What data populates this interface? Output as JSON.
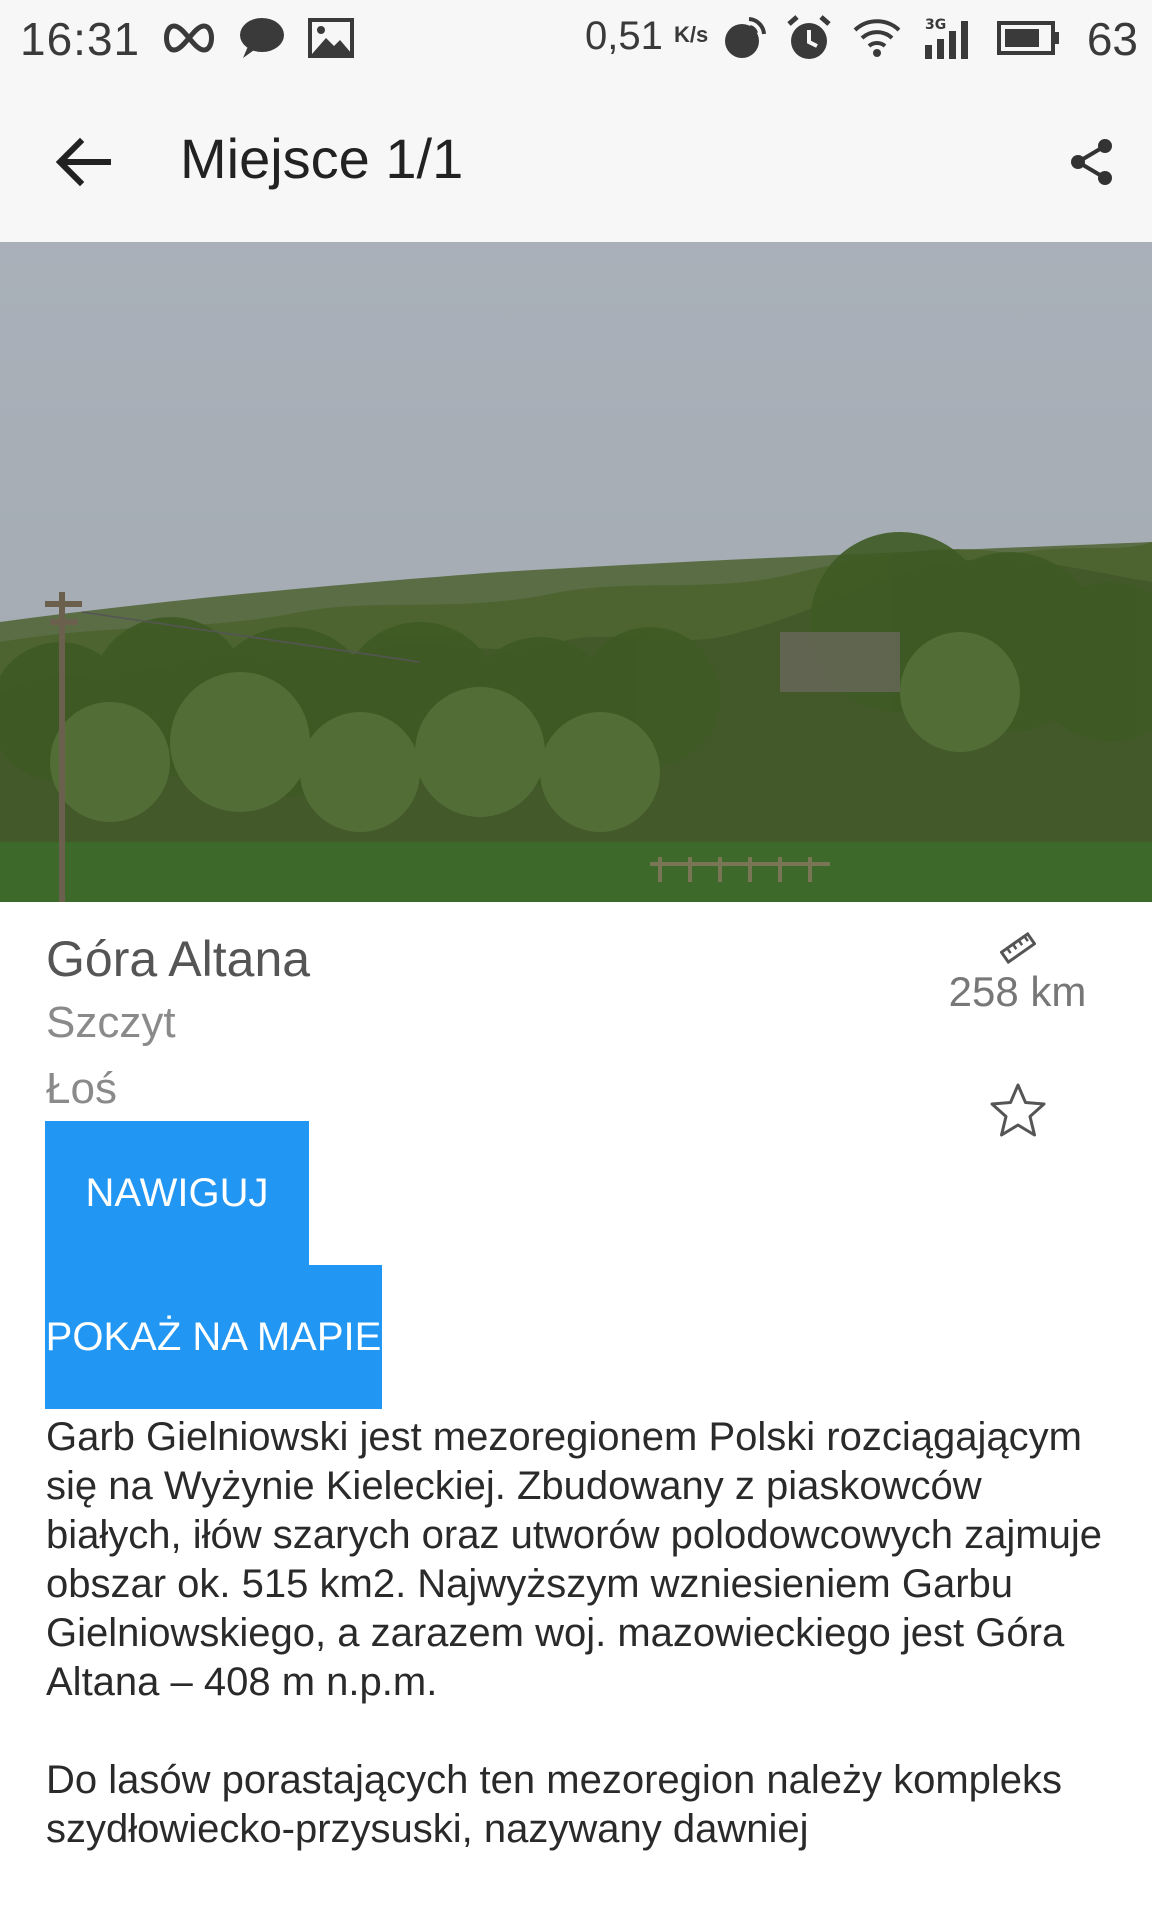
{
  "status_bar": {
    "time": "16:31",
    "network_speed": "0,51",
    "network_speed_unit": "K/s",
    "network_type": "3G",
    "battery_level": "63",
    "icons": [
      "infinity-icon",
      "chat-bubble-icon",
      "image-icon",
      "sync-icon",
      "alarm-icon",
      "wifi-icon",
      "signal-icon",
      "battery-icon"
    ]
  },
  "app_bar": {
    "title": "Miejsce 1/1",
    "back_icon": "arrow-back-icon",
    "share_icon": "share-icon"
  },
  "place": {
    "name": "Góra Altana",
    "type": "Szczyt",
    "area": "Łoś",
    "distance": "258 km",
    "distance_icon": "ruler-icon",
    "favorite_icon": "star-outline-icon"
  },
  "actions": {
    "navigate_label": "NAWIGUJ",
    "show_on_map_label": "POKAŻ NA MAPIE"
  },
  "description": "Garb Gielniowski jest mezoregionem Polski rozciągającym się na Wyżynie Kieleckiej. Zbudowany z piaskowców białych, iłów szarych oraz utworów polodowcowych zajmuje obszar ok. 515 km2. Najwyższym wzniesieniem Garbu Gielniowskiego, a zarazem woj. mazowieckiego jest Góra Altana – 408 m n.p.m.\n\nDo lasów porastających ten mezoregion należy kompleks szydłowiecko-przysuski, nazywany dawniej",
  "colors": {
    "accent": "#2196f3",
    "app_bar_background": "#f7f7f7"
  }
}
